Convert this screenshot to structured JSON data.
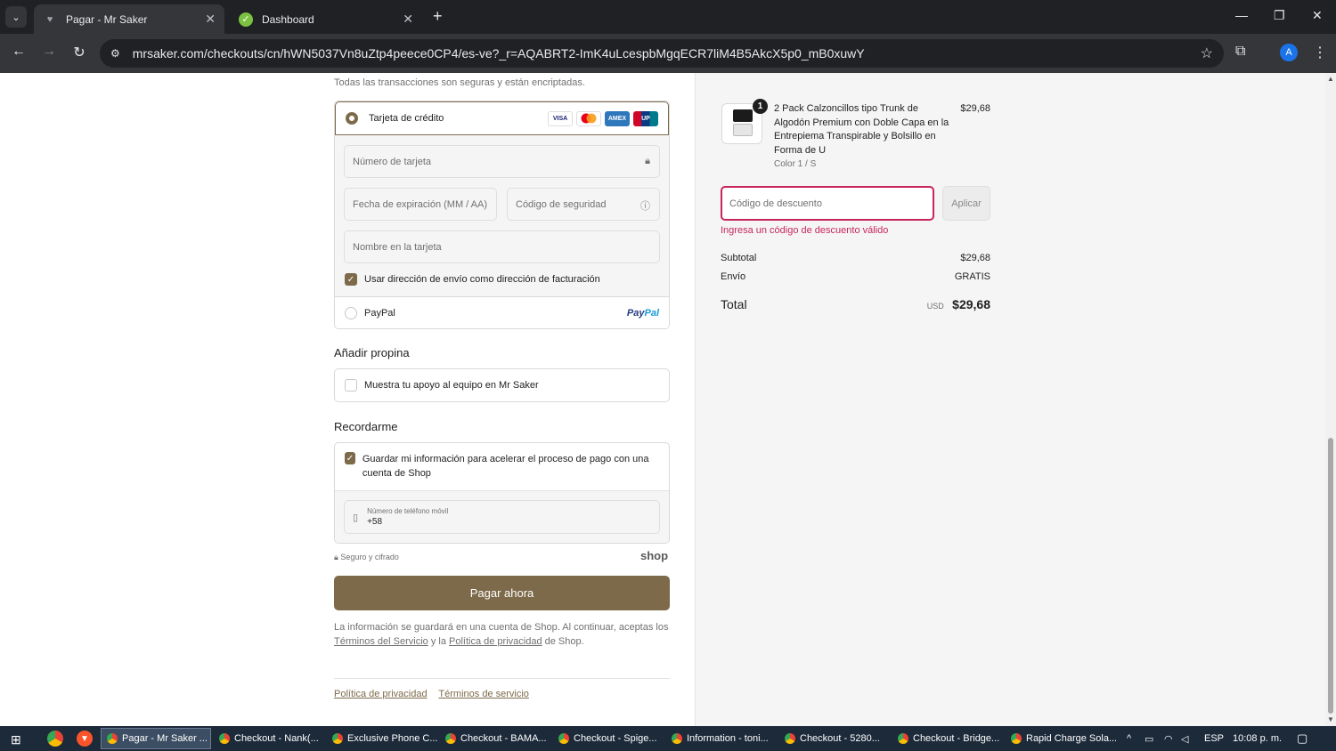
{
  "browser": {
    "tabs": [
      {
        "label": "Pagar - Mr Saker",
        "active": true
      },
      {
        "label": "Dashboard",
        "active": false
      }
    ],
    "url": "mrsaker.com/checkouts/cn/hWN5037Vn8uZtp4peece0CP4/es-ve?_r=AQABRT2-ImK4uLcespbMgqECR7liM4B5AkcX5p0_mB0xuwY",
    "profile_initial": "A"
  },
  "payment": {
    "secure_note": "Todas las transacciones son seguras y están encriptadas.",
    "credit_card_label": "Tarjeta de crédito",
    "brands": [
      "VISA",
      "MC",
      "AMEX",
      "UnionPay"
    ],
    "card_number_placeholder": "Número de tarjeta",
    "expiry_placeholder": "Fecha de expiración (MM / AA)",
    "security_code_placeholder": "Código de seguridad",
    "name_placeholder": "Nombre en la tarjeta",
    "billing_same_label": "Usar dirección de envío como dirección de facturación",
    "paypal_label": "PayPal",
    "paypal_logo_a": "Pay",
    "paypal_logo_b": "Pal"
  },
  "tip": {
    "title": "Añadir propina",
    "option_label": "Muestra tu apoyo al equipo en Mr Saker"
  },
  "remember": {
    "title": "Recordarme",
    "save_label": "Guardar mi información para acelerar el proceso de pago con una cuenta de Shop",
    "phone_label": "Número de teléfono móvil",
    "phone_value": "+58",
    "secure_label": "Seguro y cifrado",
    "shop_logo": "shop"
  },
  "pay_button": "Pagar ahora",
  "legal": {
    "text_a": "La información se guardará en una cuenta de Shop. Al continuar, aceptas los",
    "terms_link": "Términos del Servicio",
    "text_b": "y la",
    "privacy_link": "Política de privacidad",
    "text_c": "de Shop."
  },
  "footer": {
    "privacy": "Política de privacidad",
    "terms": "Términos de servicio"
  },
  "summary": {
    "quantity": "1",
    "product_name": "2 Pack Calzoncillos tipo Trunk de Algodón Premium con Doble Capa en la Entrepiema Transpirable y Bolsillo en Forma de U",
    "variant": "Color 1 / S",
    "price": "$29,68",
    "discount_placeholder": "Código de descuento",
    "apply_label": "Aplicar",
    "discount_error": "Ingresa un código de descuento válido",
    "subtotal_label": "Subtotal",
    "subtotal_value": "$29,68",
    "shipping_label": "Envío",
    "shipping_value": "GRATIS",
    "total_label": "Total",
    "currency": "USD",
    "total_value": "$29,68"
  },
  "taskbar": {
    "items": [
      "Pagar - Mr Saker ...",
      "Checkout - Nank(...",
      "Exclusive Phone C...",
      "Checkout - BAMA...",
      "Checkout - Spige...",
      "Information - toni...",
      "Checkout - 5280...",
      "Checkout - Bridge...",
      "Rapid Charge Sola..."
    ],
    "lang": "ESP",
    "time": "10:08 p. m."
  },
  "colors": {
    "accent": "#7d6a4a",
    "error": "#c8265a",
    "chrome_dark": "#202124"
  }
}
